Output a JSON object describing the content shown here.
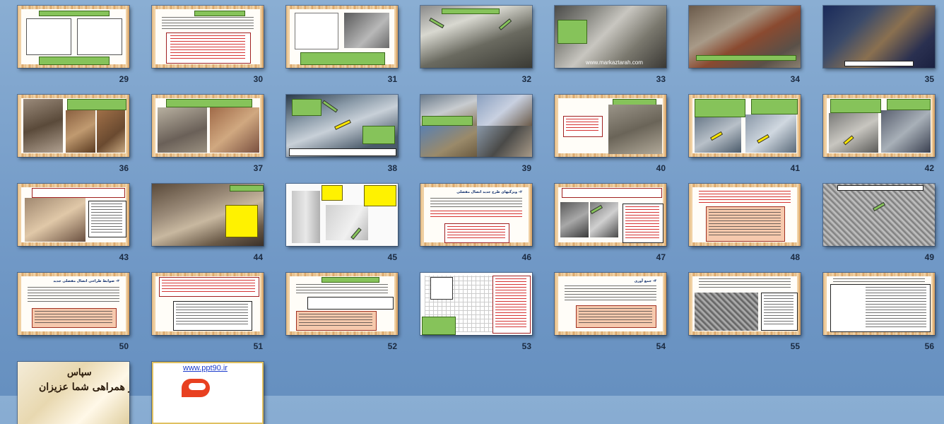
{
  "slides": [
    {
      "num": "29"
    },
    {
      "num": "30"
    },
    {
      "num": "31"
    },
    {
      "num": "32"
    },
    {
      "num": "33"
    },
    {
      "num": "34"
    },
    {
      "num": "35"
    },
    {
      "num": "36"
    },
    {
      "num": "37"
    },
    {
      "num": "38"
    },
    {
      "num": "39"
    },
    {
      "num": "40"
    },
    {
      "num": "41"
    },
    {
      "num": "42"
    },
    {
      "num": "43"
    },
    {
      "num": "44"
    },
    {
      "num": "45"
    },
    {
      "num": "46"
    },
    {
      "num": "47"
    },
    {
      "num": "48"
    },
    {
      "num": "49"
    },
    {
      "num": "50"
    },
    {
      "num": "51"
    },
    {
      "num": "52"
    },
    {
      "num": "53"
    },
    {
      "num": "54"
    },
    {
      "num": "55"
    },
    {
      "num": "56"
    },
    {
      "num": ""
    },
    {
      "num": ""
    }
  ],
  "watermark": "www.markaztarah.com",
  "slide_46_title": "۲- ویژگیهای طرح جدید اتصال مفصلی",
  "slide_50_title": "۳- ضوابط طراحی اتصال مفصلی جدید",
  "slide_54_title": "۴- جمع آوری",
  "thanks_line1": "سپاس",
  "thanks_line2": "از همراهی شما عزیزان",
  "link_text": "www.ppt90.ir",
  "colors": {
    "background": "#7ca2cc",
    "frame": "#e2b77f",
    "green_box": "#86c35a",
    "yellow_box": "#fff200",
    "pink_box": "#f6c9ad"
  }
}
